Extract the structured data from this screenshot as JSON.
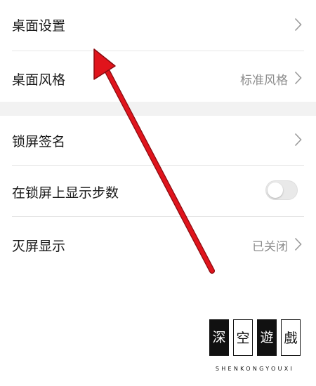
{
  "settings": {
    "items": [
      {
        "label": "桌面设置",
        "value": "",
        "control": "chevron"
      },
      {
        "label": "桌面风格",
        "value": "标准风格",
        "control": "chevron"
      },
      {
        "label": "锁屏签名",
        "value": "",
        "control": "chevron"
      },
      {
        "label": "在锁屏上显示步数",
        "value": "",
        "control": "toggle",
        "toggle_on": false
      },
      {
        "label": "灭屏显示",
        "value": "已关闭",
        "control": "chevron"
      }
    ]
  },
  "annotation": {
    "arrow_color": "#e0141c",
    "arrow_target": "桌面设置"
  },
  "watermark": {
    "chars": [
      "深",
      "空",
      "遊",
      "戲"
    ],
    "subtitle": "SHENKONGYOUXI"
  },
  "colors": {
    "background": "#ffffff",
    "section_gap": "#f2f2f2",
    "divider": "#e6e6e6",
    "secondary_text": "#8c8c8c",
    "arrow": "#e0141c"
  }
}
